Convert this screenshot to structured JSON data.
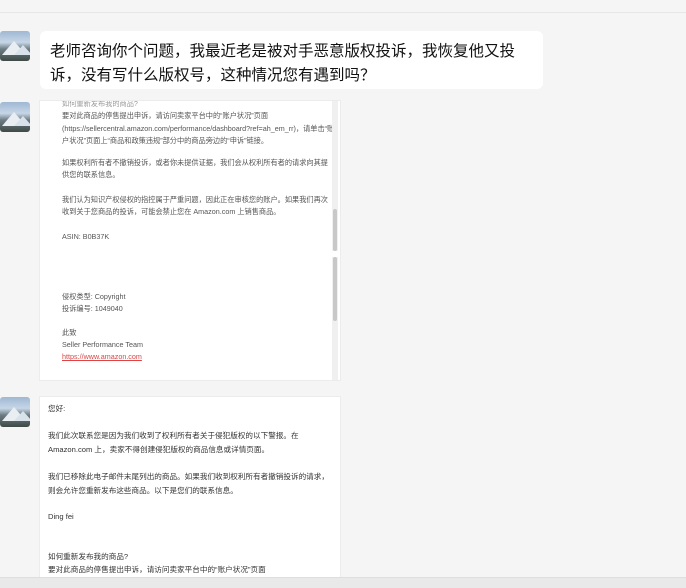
{
  "messages": [
    {
      "type": "text",
      "text": "老师咨询你个问题，我最近老是被对手恶意版权投诉，我恢复他又投诉，没有写什么版权号，这种情况您有遇到吗？"
    },
    {
      "type": "image",
      "lines": [
        "如何重新发布我的商品?",
        "要对此商品的停售提出申诉，请访问卖家平台中的“账户状况”页面",
        "(https://sellercentral.amazon.com/performance/dashboard?ref=ah_em_rr)，请单击“账",
        "户状况”页面上“商品和政策违规”部分中的商品旁边的“申诉”链接。",
        "如果权利所有者不撤销投诉，或者你未提供证据，我们会从权利所有者的请求向其提",
        "供您的联系信息。",
        "我们认为知识产权侵权的指控属于严重问题，因此正在审核您的账户。如果我们再次",
        "收到关于您商品的投诉，可能会禁止您在 Amazon.com 上销售商品。",
        "ASIN: B0B37K",
        "侵权类型: Copyright",
        "投诉编号: 1049040",
        "此致",
        "Seller Performance Team",
        "https://www.amazon.com"
      ]
    },
    {
      "type": "image",
      "lines": [
        "您好:",
        "我们此次联系您是因为我们收到了权利所有者关于侵犯版权的以下警报。在",
        "Amazon.com 上，卖家不得创建侵犯版权的商品信息或详情页面。",
        "我们已移除此电子邮件末尾列出的商品。如果我们收到权利所有者撤销投诉的请求，",
        "则会允许您重新发布这些商品。以下是您们的联系信息。",
        "Ding fei",
        "如何重新发布我的商品?",
        "要对此商品的停售提出申诉，请访问卖家平台中的“账户状况”页面"
      ]
    }
  ]
}
